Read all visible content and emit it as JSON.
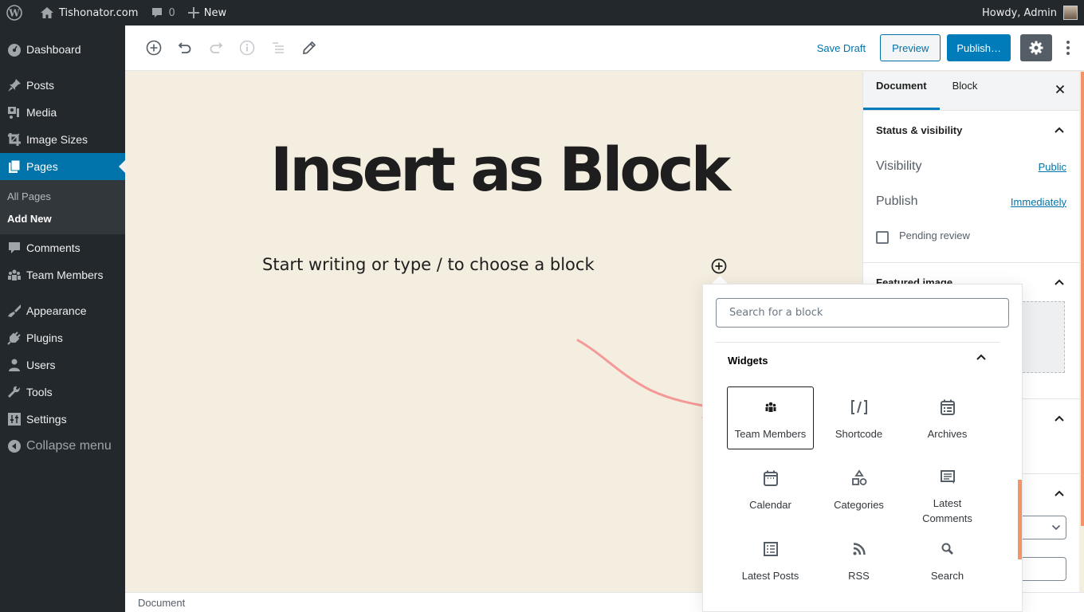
{
  "admin_bar": {
    "site_name": "Tishonator.com",
    "comments_count": "0",
    "new_label": "New",
    "greeting": "Howdy, Admin"
  },
  "sidebar": {
    "items": [
      {
        "label": "Dashboard",
        "icon": "dashboard-icon"
      },
      {
        "label": "Posts",
        "icon": "pin-icon"
      },
      {
        "label": "Media",
        "icon": "media-icon"
      },
      {
        "label": "Image Sizes",
        "icon": "crop-icon"
      },
      {
        "label": "Pages",
        "icon": "pages-icon",
        "active": true
      },
      {
        "label": "Comments",
        "icon": "comment-icon"
      },
      {
        "label": "Team Members",
        "icon": "groups-icon"
      },
      {
        "label": "Appearance",
        "icon": "brush-icon"
      },
      {
        "label": "Plugins",
        "icon": "plugin-icon"
      },
      {
        "label": "Users",
        "icon": "user-icon"
      },
      {
        "label": "Tools",
        "icon": "wrench-icon"
      },
      {
        "label": "Settings",
        "icon": "settings-icon"
      }
    ],
    "submenu": [
      {
        "label": "All Pages"
      },
      {
        "label": "Add New",
        "current": true
      }
    ],
    "collapse_label": "Collapse menu"
  },
  "toolbar": {
    "save_draft": "Save Draft",
    "preview": "Preview",
    "publish": "Publish…"
  },
  "editor": {
    "title": "Insert as Block",
    "placeholder": "Start writing or type / to choose a block"
  },
  "footer": {
    "breadcrumb": "Document"
  },
  "settings_sidebar": {
    "tabs": [
      "Document",
      "Block"
    ],
    "active_tab": "Document",
    "status_panel": {
      "title": "Status & visibility",
      "visibility_label": "Visibility",
      "visibility_value": "Public",
      "publish_label": "Publish",
      "publish_value": "Immediately",
      "pending_review_label": "Pending review",
      "pending_review_checked": false
    },
    "featured_image_title": "Featured image"
  },
  "inserter": {
    "search_placeholder": "Search for a block",
    "panel_title": "Widgets",
    "blocks": [
      {
        "label": "Team Members",
        "icon": "groups-icon",
        "selected": true
      },
      {
        "label": "Shortcode",
        "icon": "shortcode-icon"
      },
      {
        "label": "Archives",
        "icon": "archives-icon"
      },
      {
        "label": "Calendar",
        "icon": "calendar-icon"
      },
      {
        "label": "Categories",
        "icon": "categories-icon"
      },
      {
        "label": "Latest Comments",
        "icon": "comments-icon"
      },
      {
        "label": "Latest Posts",
        "icon": "list-icon"
      },
      {
        "label": "RSS",
        "icon": "rss-icon"
      },
      {
        "label": "Search",
        "icon": "search-icon"
      }
    ]
  },
  "colors": {
    "admin_dark": "#23282d",
    "accent": "#0073aa",
    "canvas_bg": "#f4eee0",
    "annotation_arrow": "#f08080"
  }
}
